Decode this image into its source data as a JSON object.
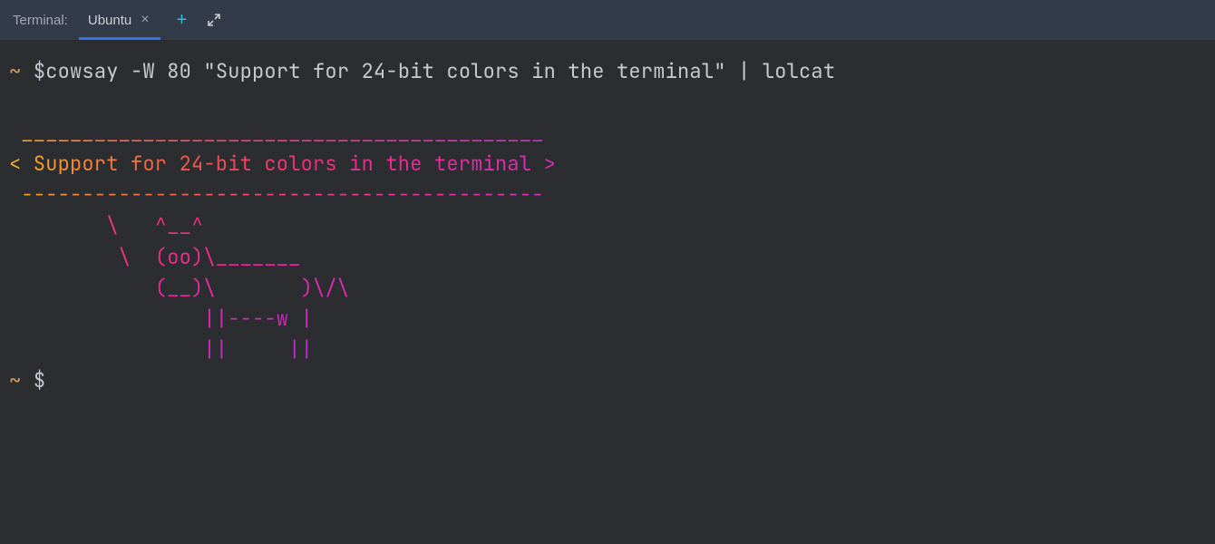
{
  "tabbar": {
    "title": "Terminal:",
    "tab_label": "Ubuntu",
    "close_glyph": "×",
    "plus_glyph": "+"
  },
  "prompt": {
    "tilde": "~",
    "dollar": "$"
  },
  "command": "cowsay -W 80 \"Support for 24-bit colors in the terminal\" | lolcat",
  "output": {
    "border_top": " ___________________________________________ ",
    "bubble": "< Support for 24-bit colors in the terminal >",
    "border_bot": " ------------------------------------------- ",
    "cow1": "        \\   ^__^",
    "cow2": "         \\  (oo)\\_______",
    "cow3": "            (__)\\       )\\/\\",
    "cow4": "                ||----w |",
    "cow5": "                ||     ||"
  },
  "colors": {
    "grad_top": "linear-gradient(90deg,#f5a623 0%,#f76a4b 20%,#ef426f 40%,#e8368f 60%,#e02fb0 80%,#c930c9 100%)",
    "grad_bubble": "linear-gradient(90deg,#f7b12c 0%,#f48a32 12%,#f05a49 32%,#ec2f7a 55%,#e82a9c 75%,#d42db8 100%)",
    "grad_botline": "linear-gradient(90deg,#f6a22d 0%,#f46b3f 25%,#ee3d77 50%,#e92ea1 75%,#d22fba 100%)",
    "grad_cow1": "linear-gradient(90deg,#f35d46 0%,#ef4063 40%,#ec2e83 100%)",
    "grad_cow2": "linear-gradient(90deg,#ef4267 0%,#ec2d82 45%,#e529a0 100%)",
    "grad_cow3": "linear-gradient(90deg,#ec2f81 0%,#e7289c 45%,#d92ab4 100%)",
    "grad_cow4": "linear-gradient(90deg,#e6279c 0%,#dd28b0 50%,#ca2ac0 100%)",
    "grad_cow5": "linear-gradient(90deg,#dc26ad 0%,#cd27bd 50%,#b92ac9 100%)"
  }
}
